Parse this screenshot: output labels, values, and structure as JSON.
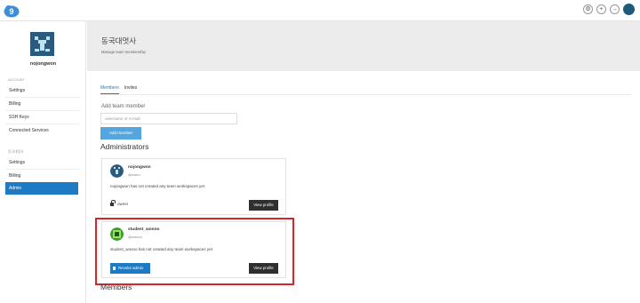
{
  "topbar": {
    "logo_icon": "cloud9-logo-icon",
    "icons": [
      "gear-icon",
      "plus-icon",
      "logout-icon",
      "user-avatar-icon"
    ]
  },
  "sidebar": {
    "username": "nojongwon",
    "account_section": "ACCOUNT",
    "account_items": [
      "Settings",
      "Billing",
      "SSH Keys",
      "Connected Services"
    ],
    "team_section": "동국대멋사",
    "team_items": [
      "Settings",
      "Billing",
      "Admin"
    ],
    "active_item": "Admin"
  },
  "header": {
    "title": "동국대멋사",
    "subtitle": "Manage team membership"
  },
  "tabs": [
    {
      "label": "Members",
      "active": true
    },
    {
      "label": "Invites",
      "active": false
    }
  ],
  "add_member": {
    "label": "Add team member",
    "placeholder": "username or e-mail",
    "button": "Add member"
  },
  "administrators_heading": "Administrators",
  "admins": [
    {
      "name": "nojongwon",
      "handle": "@uwno",
      "description": "nojongwon has not created any team workspaces yet",
      "role": "owner",
      "view_button": "View profile"
    },
    {
      "name": "student_wonno",
      "handle": "@wonno",
      "description": "student_wonno has not created any team workspaces yet",
      "revoke_button": "Revoke admin",
      "view_button": "View profile"
    }
  ],
  "members_heading": "Members",
  "colors": {
    "accent": "#1f7ac4",
    "highlight": "#d9232a",
    "header_bg": "#ececec"
  }
}
